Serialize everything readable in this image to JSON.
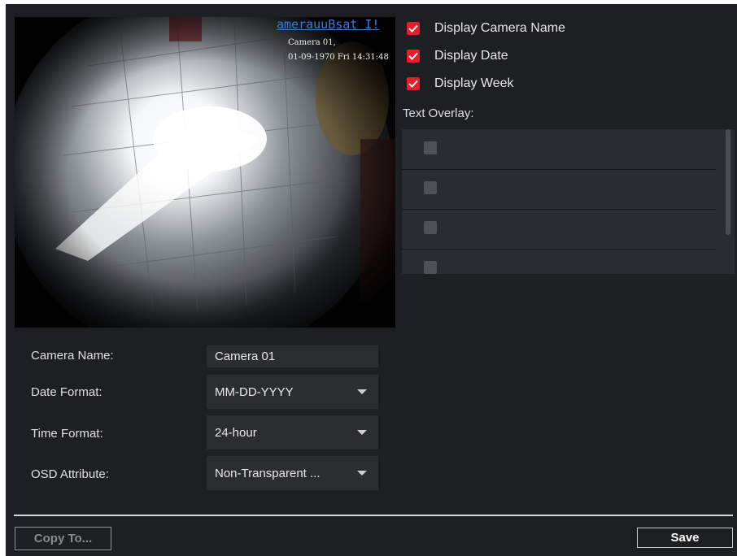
{
  "preview": {
    "osd_top": "amerauuBsat I!",
    "osd_camera": "Camera 01,",
    "osd_datetime": "01-09-1970 Fri 14:31:48"
  },
  "display_options": [
    {
      "label": "Display Camera Name",
      "checked": true
    },
    {
      "label": "Display Date",
      "checked": true
    },
    {
      "label": "Display Week",
      "checked": true
    }
  ],
  "text_overlay": {
    "title": "Text Overlay:",
    "rows": [
      {
        "checked": false
      },
      {
        "checked": false
      },
      {
        "checked": false
      },
      {
        "checked": false
      }
    ]
  },
  "form": {
    "camera_name": {
      "label": "Camera Name:",
      "value": "Camera 01"
    },
    "date_format": {
      "label": "Date Format:",
      "value": "MM-DD-YYYY"
    },
    "time_format": {
      "label": "Time Format:",
      "value": "24-hour"
    },
    "osd_attribute": {
      "label": "OSD Attribute:",
      "value": "Non-Transparent ..."
    }
  },
  "buttons": {
    "copy_to": "Copy To...",
    "save": "Save"
  },
  "colors": {
    "background": "#1e1f22",
    "checkbox_checked": "#e41e2b",
    "field_bg": "#2c2d31"
  }
}
